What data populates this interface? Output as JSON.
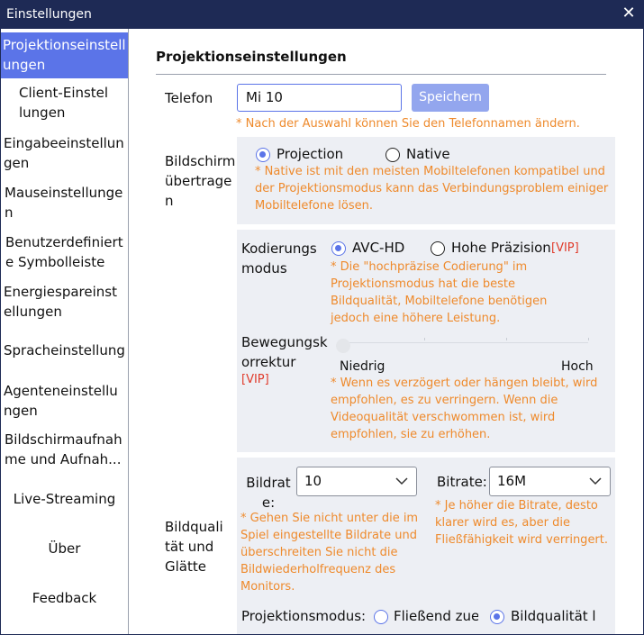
{
  "window": {
    "title": "Einstellungen"
  },
  "sidebar": {
    "items": [
      {
        "label": "Projektionseinstellungen"
      },
      {
        "label": "Client-Einstellungen"
      },
      {
        "label": "Eingabeeinstellungen"
      },
      {
        "label": "Mauseinstellungen"
      },
      {
        "label": "Benutzerdefinierte Symbolleiste"
      },
      {
        "label": "Energiespareinstellungen"
      },
      {
        "label": "Spracheinstellung"
      },
      {
        "label": "Agenteneinstellungen"
      },
      {
        "label": "Bildschirmaufnahme und Aufnah..."
      },
      {
        "label": "Live-Streaming"
      },
      {
        "label": "Über"
      },
      {
        "label": "Feedback"
      }
    ]
  },
  "main": {
    "heading": "Projektionseinstellungen",
    "phone": {
      "label": "Telefon",
      "value": "Mi 10",
      "save_label": "Speichern",
      "note": "* Nach der Auswahl können Sie den Telefonnamen ändern."
    },
    "screen_transfer": {
      "label": "Bildschirmübertragen",
      "option_projection": "Projection",
      "option_native": "Native",
      "note": "* Native ist mit den meisten Mobiltelefonen kompatibel und der Projektionsmodus kann das Verbindungsproblem einiger Mobiltelefone lösen."
    },
    "encoding": {
      "label": "Kodierungsmodus",
      "option_avc": "AVC-HD",
      "option_high": "Hohe Präzision",
      "vip": "[VIP]",
      "note": "* Die \"hochpräzise Codierung\" im Projektionsmodus hat die beste Bildqualität, Mobiltelefone benötigen jedoch eine höhere Leistung."
    },
    "motion": {
      "label": "Bewegungskorrektur",
      "vip": "[VIP]",
      "low": "Niedrig",
      "high": "Hoch",
      "level": 0,
      "note": "* Wenn es verzögert oder hängen bleibt, wird empfohlen, es zu verringern. Wenn die Videoqualität verschwommen ist, wird empfohlen, sie zu erhöhen."
    },
    "quality": {
      "label": "Bildqualität und Glätte",
      "framerate_label": "Bildrate:",
      "framerate_value": "10",
      "framerate_note": "* Gehen Sie nicht unter die im Spiel eingestellte Bildrate und überschreiten Sie nicht die Bildwiederholfrequenz des Monitors.",
      "bitrate_label": "Bitrate:",
      "bitrate_value": "16M",
      "bitrate_note": "* Je höher die Bitrate, desto klarer wird es, aber die Fließfähigkeit wird verringert.",
      "mode_label": "Projektionsmodus:",
      "mode_smooth": "Fließend zue",
      "mode_quality": "Bildqualität l"
    }
  },
  "colors": {
    "titlebar": "#1e2a55",
    "accent": "#5b74e8",
    "note": "#ee8a2c",
    "vip": "#e03a2a",
    "panel": "#edeff4"
  }
}
